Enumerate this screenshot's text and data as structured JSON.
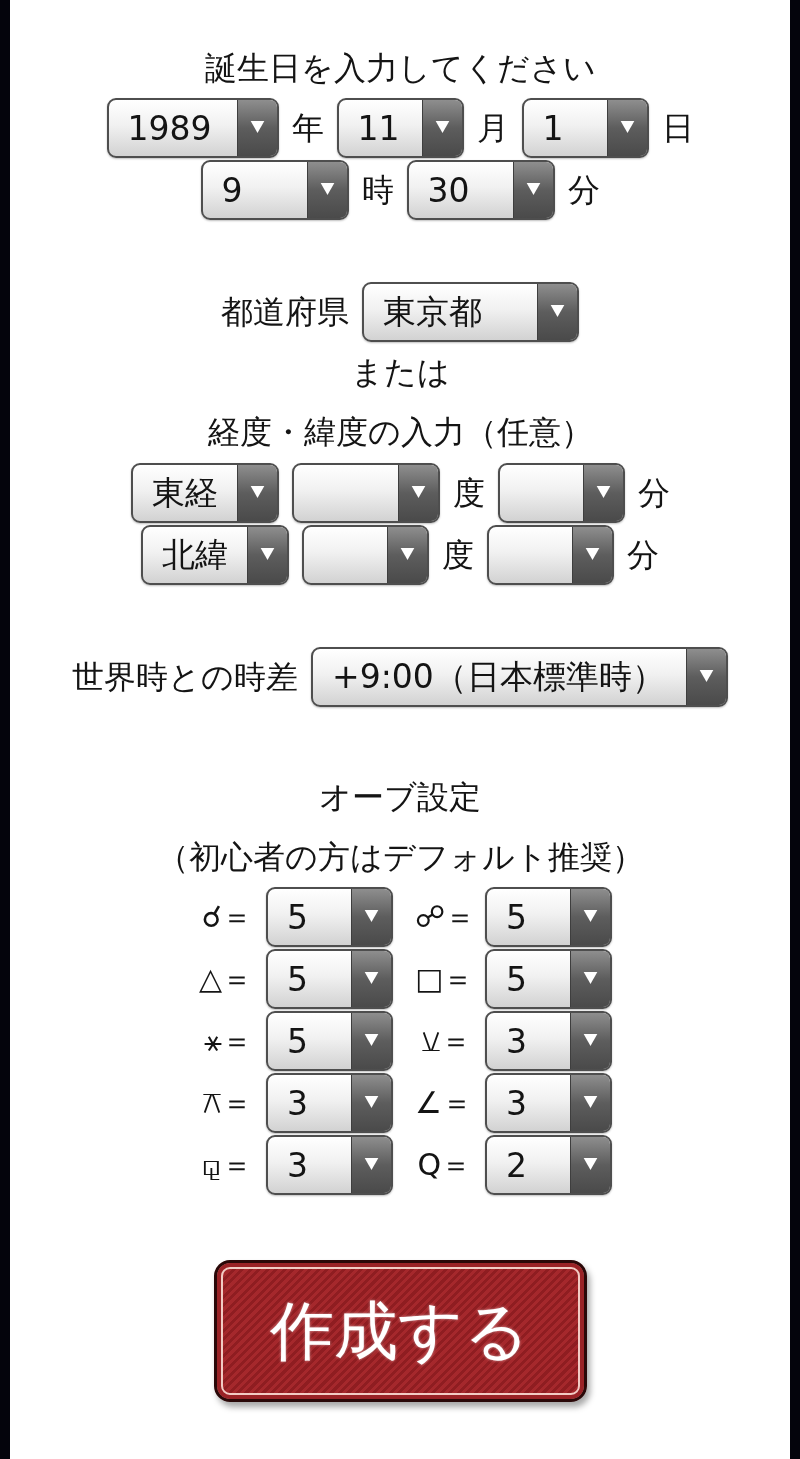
{
  "birth_date": {
    "heading": "誕生日を入力してください",
    "rows": [
      {
        "fields": [
          {
            "value": "1989",
            "unit": "年"
          },
          {
            "value": "11",
            "unit": "月"
          },
          {
            "value": "1",
            "unit": "日"
          }
        ]
      },
      {
        "fields": [
          {
            "value": "9",
            "unit": "時"
          },
          {
            "value": "30",
            "unit": "分"
          }
        ]
      }
    ]
  },
  "prefecture": {
    "label": "都道府県",
    "value": "東京都"
  },
  "or_text": "または",
  "coordinates": {
    "heading": "経度・緯度の入力（任意）",
    "rows": [
      {
        "direction": "東経",
        "degree_unit": "度",
        "minute_unit": "分"
      },
      {
        "direction": "北緯",
        "degree_unit": "度",
        "minute_unit": "分"
      }
    ]
  },
  "time_difference": {
    "label": "世界時との時差",
    "value": "+9:00（日本標準時）"
  },
  "orb_settings": {
    "heading": "オーブ設定",
    "note": "（初心者の方はデフォルト推奨）",
    "items": [
      {
        "label": "☌＝",
        "value": "5"
      },
      {
        "label": "☍＝",
        "value": "5"
      },
      {
        "label": "△＝",
        "value": "5"
      },
      {
        "label": "□＝",
        "value": "5"
      },
      {
        "label": "⚹＝",
        "value": "5"
      },
      {
        "label": "⚺＝",
        "value": "3"
      },
      {
        "label": "⚻＝",
        "value": "3"
      },
      {
        "label": "∠＝",
        "value": "3"
      },
      {
        "label": "⚼＝",
        "value": "3"
      },
      {
        "label": "Q＝",
        "value": "2"
      }
    ]
  },
  "submit_button": {
    "label": "作成する"
  }
}
